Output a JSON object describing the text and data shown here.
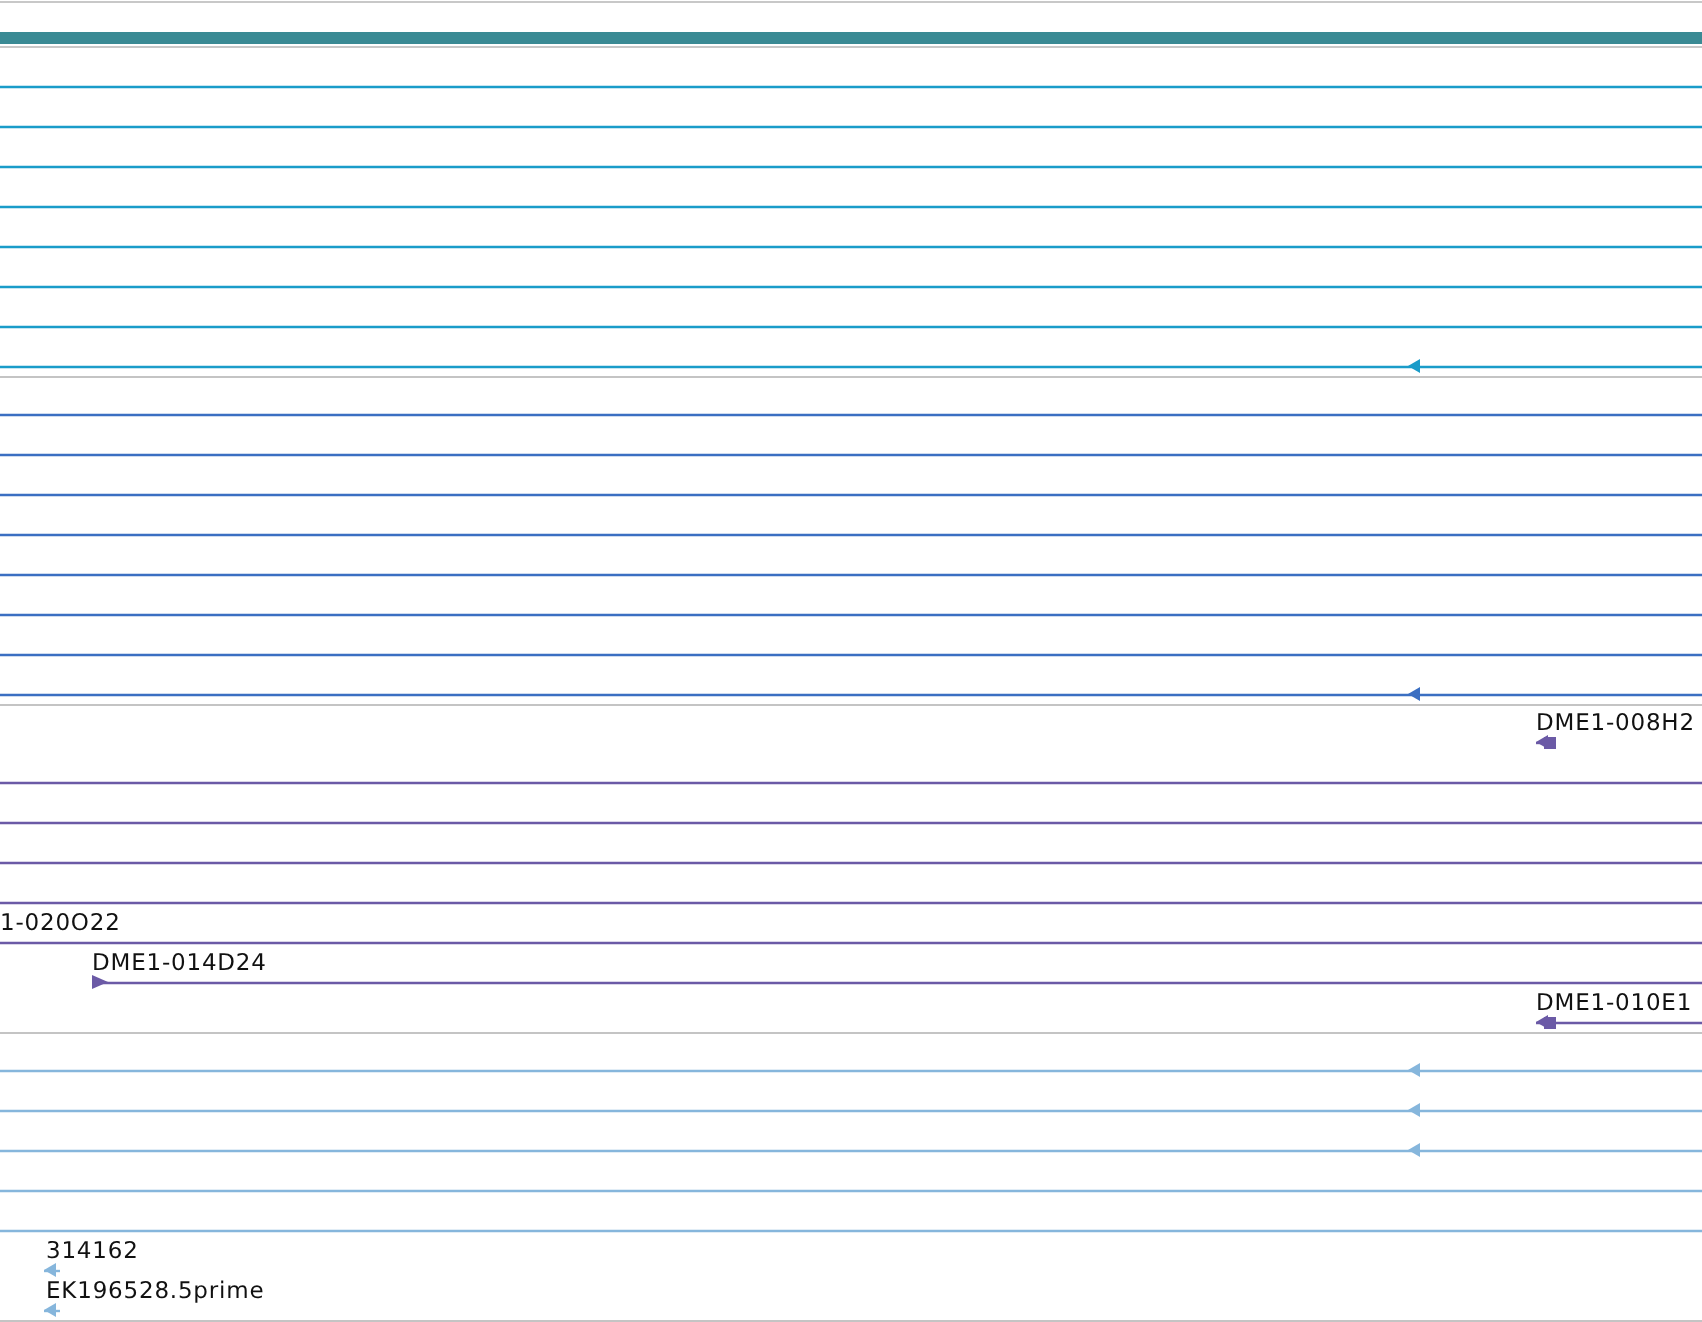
{
  "tracks": [
    {
      "color": "#1a9cc9",
      "features": [
        {
          "kind": "line"
        },
        {
          "kind": "line"
        },
        {
          "kind": "line"
        },
        {
          "kind": "line"
        },
        {
          "kind": "line"
        },
        {
          "kind": "line"
        },
        {
          "kind": "line"
        },
        {
          "kind": "reverse"
        }
      ]
    },
    {
      "color": "#3b6fc2",
      "features": [
        {
          "kind": "line"
        },
        {
          "kind": "line"
        },
        {
          "kind": "line"
        },
        {
          "kind": "line"
        },
        {
          "kind": "line"
        },
        {
          "kind": "line"
        },
        {
          "kind": "line"
        },
        {
          "kind": "reverse"
        }
      ]
    },
    {
      "color": "#6b5aa6",
      "features": [
        {
          "label": "DME1-008H2",
          "kind": "reverse"
        },
        {
          "kind": "line"
        },
        {
          "kind": "line"
        },
        {
          "kind": "line"
        },
        {
          "kind": "line"
        },
        {
          "label": "1-020O22",
          "kind": "line"
        },
        {
          "label": "DME1-014D24",
          "kind": "forward"
        },
        {
          "label": "DME1-010E1",
          "kind": "reverse"
        }
      ]
    },
    {
      "color": "#86b6dc",
      "features": [
        {
          "kind": "reverse"
        },
        {
          "kind": "reverse"
        },
        {
          "kind": "reverse"
        },
        {
          "kind": "line"
        },
        {
          "kind": "line"
        },
        {
          "label": "314162",
          "kind": "reverse"
        },
        {
          "label": "EK196528.5prime",
          "kind": "reverse"
        }
      ]
    }
  ]
}
